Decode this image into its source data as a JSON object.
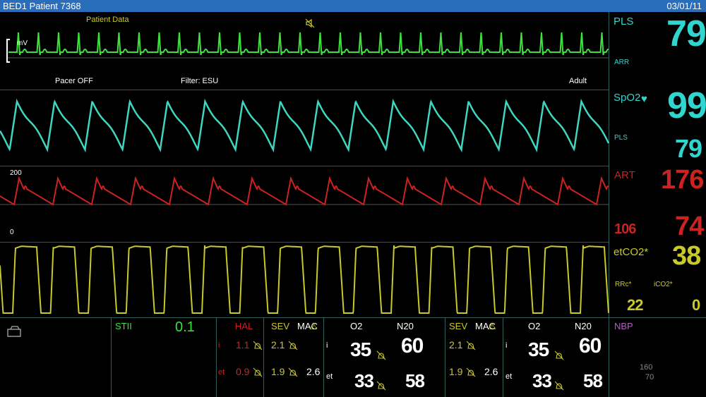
{
  "header": {
    "title": "BED1 Patient 7368",
    "date": "03/01/11"
  },
  "ecg": {
    "label": "Patient Data",
    "unit": "mV",
    "pacer": "Pacer OFF",
    "filter": "Filter: ESU",
    "mode": "Adult",
    "muted_icon": "alarm-muted-icon"
  },
  "art_scale": {
    "top": "200",
    "bottom": "0"
  },
  "vitals": {
    "pls_label": "PLS",
    "pls_value": "79",
    "arr_label": "ARR",
    "spo2_label": "SpO2",
    "spo2_value": "99",
    "spo2_pls_label": "PLS",
    "spo2_pls_value": "79",
    "art_label": "ART",
    "art_sys": "176",
    "art_dia": "106",
    "art_mean": "74",
    "etco2_label": "etCO2*",
    "etco2_value": "38",
    "rrc_label": "RRc*",
    "rrc_value": "22",
    "ico2_label": "iCO2*",
    "ico2_value": "0"
  },
  "bottom": {
    "stii_label": "STII",
    "stii_value": "0.1",
    "hal_label": "HAL",
    "hal_i": "1.1",
    "hal_et": "0.9",
    "i_label": "i",
    "et_label": "et",
    "sev1_label": "SEV",
    "mac1_label": "MAC",
    "sev1_i": "2.1",
    "sev1_et": "1.9",
    "mac1_value": "2.6",
    "gas1_o2_label": "O2",
    "gas1_n2o_label": "N20",
    "gas1_o2_i": "35",
    "gas1_n2o_i": "60",
    "gas1_o2_et": "33",
    "gas1_n2o_et": "58",
    "sev2_label": "SEV",
    "mac2_label": "MAC",
    "sev2_i": "2.1",
    "sev2_et": "1.9",
    "mac2_value": "2.6",
    "gas2_o2_label": "O2",
    "gas2_n2o_label": "N20",
    "gas2_o2_i": "35",
    "gas2_n2o_i": "60",
    "gas2_o2_et": "33",
    "gas2_n2o_et": "58",
    "nbp_label": "NBP",
    "nbp_sys": "160",
    "nbp_dia": "70"
  },
  "colors": {
    "ecg": "#3ee03e",
    "pleth": "#3fd6c0",
    "art": "#cc2222",
    "co2": "#c9c92a",
    "nbp": "#b060c0",
    "teal_text": "#2fd6d0",
    "header": "#2a6ebb"
  }
}
